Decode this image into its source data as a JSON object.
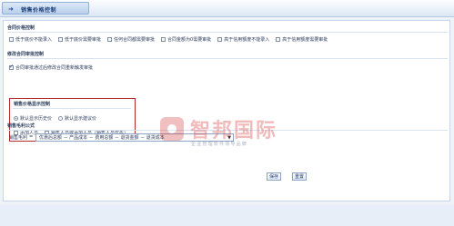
{
  "header": {
    "title": "销售价格控制"
  },
  "sections": {
    "contract_price": {
      "title": "合同价格控制",
      "options": [
        {
          "label": "低于底价不能录入",
          "checked": false
        },
        {
          "label": "低于底价需要审批",
          "checked": false
        },
        {
          "label": "任何合同都需要审批",
          "checked": false
        },
        {
          "label": "合同金额为0需要审批",
          "checked": false
        },
        {
          "label": "高于信用额度不能录入",
          "checked": false
        },
        {
          "label": "高于信用额度需要审批",
          "checked": false
        }
      ]
    },
    "modify_contract": {
      "title": "修改合同审批控制",
      "options": [
        {
          "label": "合同审批通过后修改合同重新触发审批",
          "checked": true
        }
      ]
    },
    "price_display": {
      "title": "销售价格显示控制",
      "radios": [
        {
          "label": "默认显示历史价",
          "checked": true
        },
        {
          "label": "默认显示建议价",
          "checked": false
        }
      ],
      "checkboxes": [
        {
          "label": "添加人员",
          "checked": false
        },
        {
          "label": "销售人员或添加人员（销售人员优先）",
          "checked": false
        }
      ]
    },
    "gross_margin": {
      "title": "销售毛利公式",
      "label": "销售毛利",
      "operator": "=",
      "formula_value": "优惠后总额 － 产品成本 － 费用总额 － 退货金额 － 退货成本"
    }
  },
  "buttons": {
    "save": "保存",
    "reset": "重置"
  },
  "watermark": {
    "brand": "智邦国际",
    "tagline": "企业管理软件领导品牌"
  },
  "colors": {
    "highlight_border": "#b52a2a",
    "header_text": "#1a3d74",
    "watermark_red": "#d83030"
  }
}
